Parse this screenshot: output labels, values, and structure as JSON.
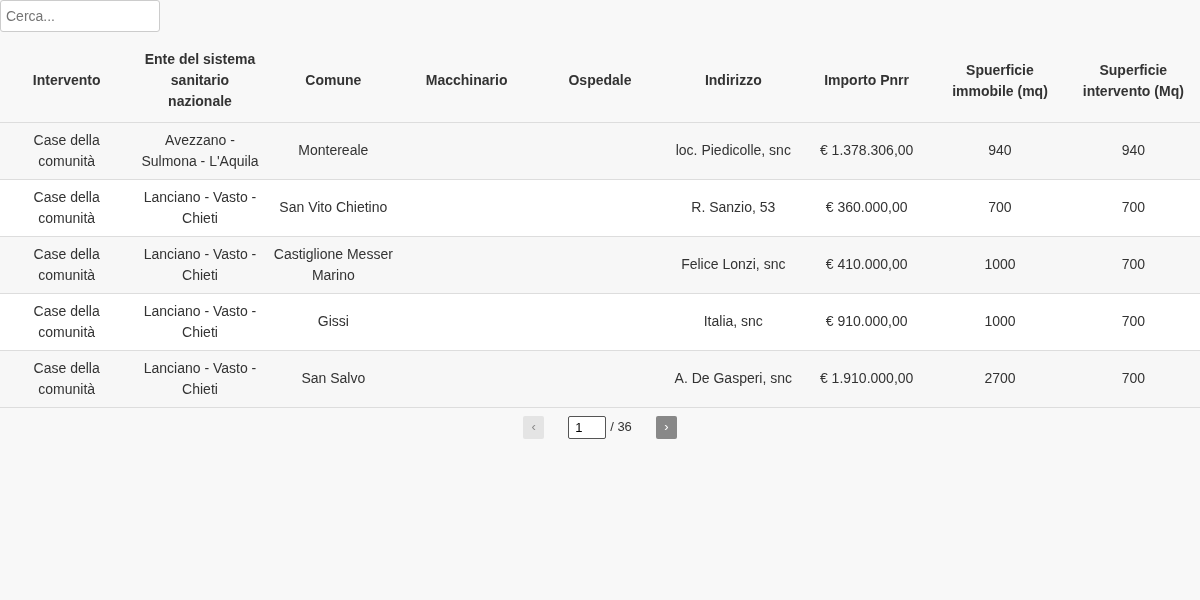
{
  "search": {
    "placeholder": "Cerca..."
  },
  "table": {
    "columns": [
      "Intervento",
      "Ente del sistema sanitario nazionale",
      "Comune",
      "Macchinario",
      "Ospedale",
      "Indirizzo",
      "Importo Pnrr",
      "Spuerficie immobile (mq)",
      "Superficie intervento (Mq)"
    ],
    "rows": [
      [
        "Case della comunità",
        "Avezzano - Sulmona - L'Aquila",
        "Montereale",
        "",
        "",
        "loc. Piedicolle, snc",
        "€ 1.378.306,00",
        "940",
        "940"
      ],
      [
        "Case della comunità",
        "Lanciano - Vasto - Chieti",
        "San Vito Chietino",
        "",
        "",
        "R. Sanzio, 53",
        "€ 360.000,00",
        "700",
        "700"
      ],
      [
        "Case della comunità",
        "Lanciano - Vasto - Chieti",
        "Castiglione Messer Marino",
        "",
        "",
        "Felice Lonzi, snc",
        "€ 410.000,00",
        "1000",
        "700"
      ],
      [
        "Case della comunità",
        "Lanciano - Vasto - Chieti",
        "Gissi",
        "",
        "",
        "Italia, snc",
        "€ 910.000,00",
        "1000",
        "700"
      ],
      [
        "Case della comunità",
        "Lanciano - Vasto - Chieti",
        "San Salvo",
        "",
        "",
        "A. De Gasperi, snc",
        "€ 1.910.000,00",
        "2700",
        "700"
      ]
    ]
  },
  "pagination": {
    "prev": {
      "label": "‹",
      "disabled": true
    },
    "page": "1",
    "total": "/ 36",
    "next": {
      "label": "›",
      "disabled": false
    }
  }
}
